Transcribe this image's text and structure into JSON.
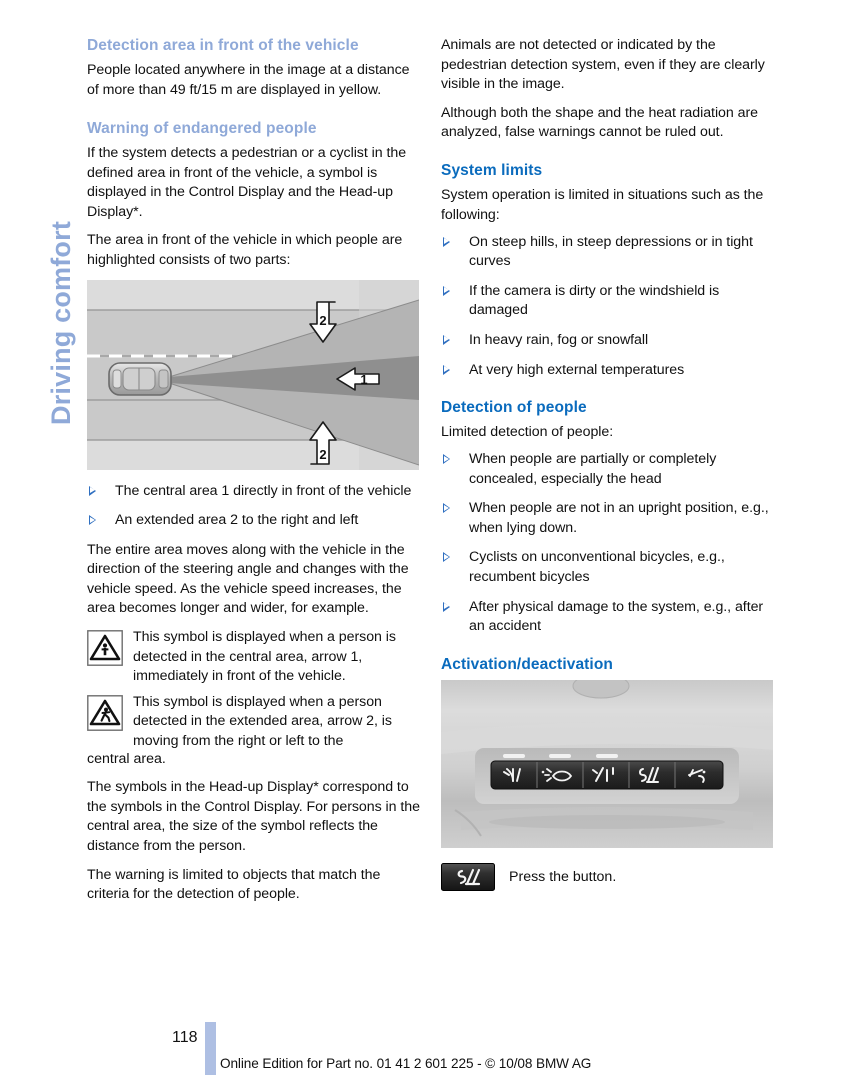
{
  "chapter": {
    "tab_label": "Driving comfort"
  },
  "left_column": {
    "heading_1": "Detection area in front of the vehicle",
    "para_1": "People located anywhere in the image at a distance of more than 49 ft/15 m are displayed in yellow.",
    "heading_2": "Warning of endangered people",
    "para_2": "If the system detects a pedestrian or a cyclist in the defined area in front of the vehicle, a symbol is displayed in the Control Display and the Head-up Display*.",
    "para_3": "The area in front of the vehicle in which people are highlighted consists of two parts:",
    "figure": {
      "name": "detection-area-diagram",
      "callout_1": "1",
      "callout_2a": "2",
      "callout_2b": "2"
    },
    "bullets": [
      "The central area 1 directly in front of the vehicle",
      "An extended area 2 to the right and left"
    ],
    "para_4": "The entire area moves along with the vehicle in the direction of the steering angle and changes with the vehicle speed. As the vehicle speed increases, the area becomes longer and wider, for example.",
    "symbol_1": {
      "icon": "pedestrian-warning-triangle-standing-icon",
      "text": "This symbol is displayed when a person is detected in the central area, arrow 1, immediately in front of the vehicle."
    },
    "symbol_2": {
      "icon": "pedestrian-warning-triangle-walking-icon",
      "text": "This symbol is displayed when a person detected in the extended area, arrow 2, is moving from the right or left to the"
    },
    "symbol_2_continued": "central area.",
    "para_5": "The symbols in the Head-up Display* correspond to the symbols in the Control Display. For persons in the central area, the size of the symbol reflects the distance from the person.",
    "para_6": "The warning is limited to objects that match the criteria for the detection of people."
  },
  "right_column": {
    "para_1": "Animals are not detected or indicated by the pedestrian detection system, even if they are clearly visible in the image.",
    "para_2": "Although both the shape and the heat radiation are analyzed, false warnings cannot be ruled out.",
    "heading_1": "System limits",
    "para_3": "System operation is limited in situations such as the following:",
    "bullets_1": [
      "On steep hills, in steep depressions or in tight curves",
      "If the camera is dirty or the windshield is damaged",
      "In heavy rain, fog or snowfall",
      "At very high external temperatures"
    ],
    "heading_2": "Detection of people",
    "para_4": "Limited detection of people:",
    "bullets_2": [
      "When people are partially or completely concealed, especially the head",
      "When people are not in an upright position, e.g., when lying down.",
      "Cyclists on unconventional bicycles, e.g., recumbent bicycles",
      "After physical damage to the system, e.g., after an accident"
    ],
    "heading_3": "Activation/deactivation",
    "photo": {
      "name": "overhead-console-buttons-photo",
      "buttons": [
        "high-beam-assistant-button",
        "headlight-washer-button",
        "hazard-lane-button",
        "night-vision-pedestrian-button",
        "seat-adjust-button"
      ]
    },
    "press_instruction": {
      "icon": "night-vision-pedestrian-button-icon",
      "text": "Press the button."
    }
  },
  "footer": {
    "page_number": "118",
    "text": "Online Edition for Part no. 01 41 2 601 225 - © 10/08 BMW AG"
  },
  "colors": {
    "heading_muted": "#8fa9d8",
    "heading_strong": "#0a6bbd",
    "bullet": "#2f6fc0",
    "footer_bar": "#aebfe3"
  }
}
